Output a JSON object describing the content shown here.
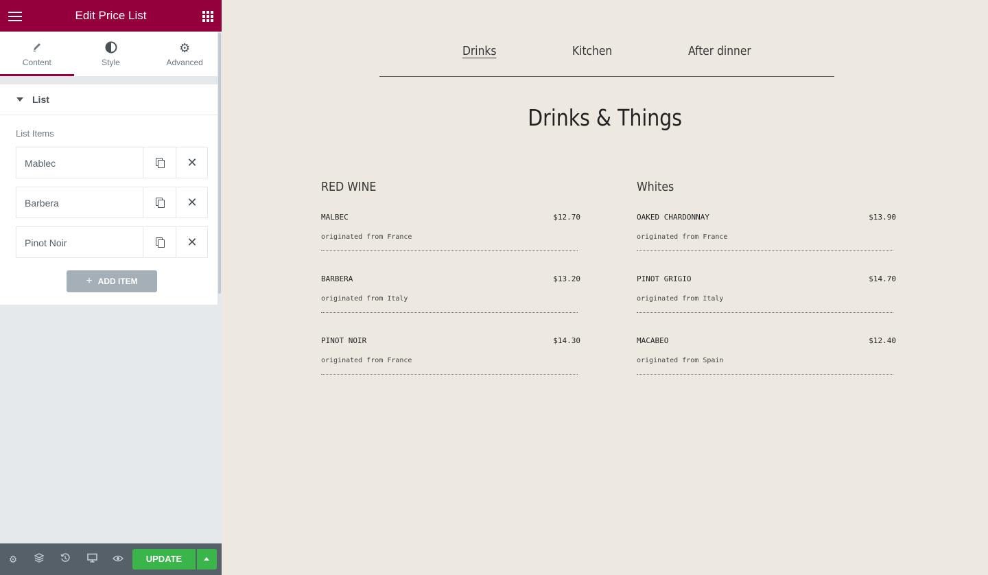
{
  "panel": {
    "title": "Edit Price List",
    "tabs": [
      {
        "label": "Content",
        "icon": "pencil-icon",
        "active": true
      },
      {
        "label": "Style",
        "icon": "half-circle-icon",
        "active": false
      },
      {
        "label": "Advanced",
        "icon": "gear-icon",
        "active": false
      }
    ],
    "section_title": "List",
    "list_label": "List Items",
    "items": [
      {
        "title": "Mablec"
      },
      {
        "title": "Barbera"
      },
      {
        "title": "Pinot Noir"
      }
    ],
    "add_item_label": "ADD ITEM",
    "footer": {
      "icons": [
        "gear-icon",
        "layers-icon",
        "history-icon",
        "responsive-icon",
        "eye-icon"
      ],
      "update_label": "UPDATE"
    },
    "colors": {
      "brand": "#93003c",
      "update": "#39b54a",
      "add_item": "#a4afb7"
    }
  },
  "preview": {
    "nav": [
      {
        "label": "Drinks",
        "active": true
      },
      {
        "label": "Kitchen",
        "active": false
      },
      {
        "label": "After dinner",
        "active": false
      }
    ],
    "heading": "Drinks & Things",
    "columns": [
      {
        "title": "RED WINE",
        "items": [
          {
            "name": "MALBEC",
            "price": "$12.70",
            "desc": "originated from France"
          },
          {
            "name": "BARBERA",
            "price": "$13.20",
            "desc": "originated from Italy"
          },
          {
            "name": "PINOT NOIR",
            "price": "$14.30",
            "desc": "originated from France"
          }
        ]
      },
      {
        "title": "Whites",
        "items": [
          {
            "name": "OAKED CHARDONNAY",
            "price": "$13.90",
            "desc": "originated from France"
          },
          {
            "name": "PINOT GRIGIO",
            "price": "$14.70",
            "desc": "originated from Italy"
          },
          {
            "name": "MACABEO",
            "price": "$12.40",
            "desc": "originated from Spain"
          }
        ]
      }
    ],
    "colors": {
      "background": "#ede9e1"
    }
  }
}
